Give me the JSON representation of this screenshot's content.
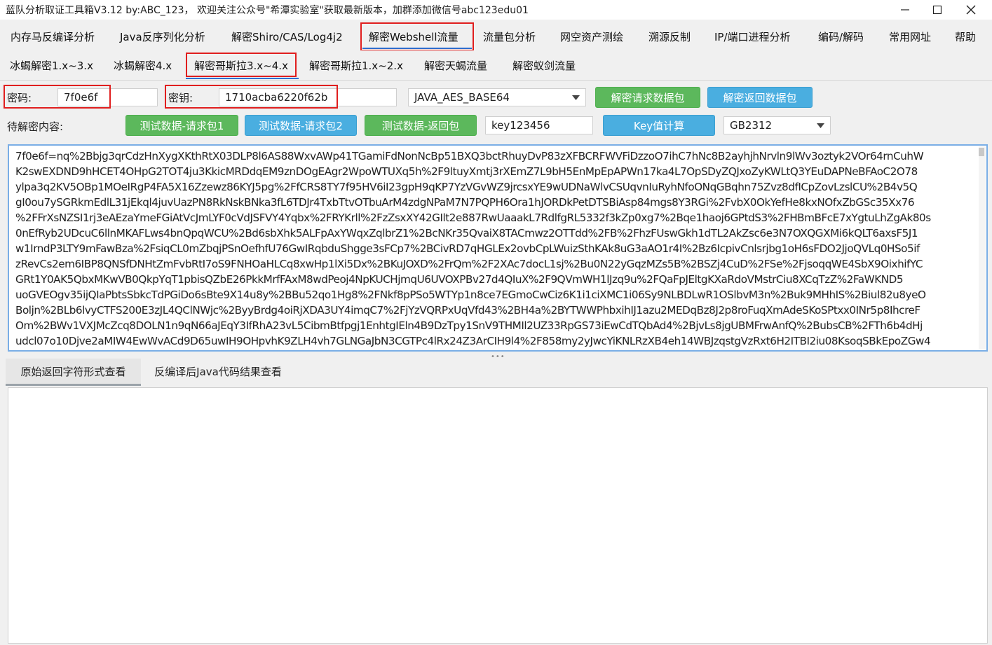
{
  "window": {
    "title": "蓝队分析取证工具箱V3.12 by:ABC_123， 欢迎关注公众号\"希潭实验室\"获取最新版本，加群添加微信号abc123edu01"
  },
  "menu": {
    "items": [
      {
        "label": "内存马反编译分析"
      },
      {
        "label": "Java反序列化分析"
      },
      {
        "label": "解密Shiro/CAS/Log4j2"
      },
      {
        "label": "解密Webshell流量"
      },
      {
        "label": "流量包分析"
      },
      {
        "label": "网空资产测绘"
      },
      {
        "label": "溯源反制"
      },
      {
        "label": "IP/端口进程分析"
      },
      {
        "label": "编码/解码"
      },
      {
        "label": "常用网址"
      },
      {
        "label": "帮助"
      }
    ],
    "active": "解密Webshell流量"
  },
  "subtabs": {
    "items": [
      {
        "label": "冰蝎解密1.x~3.x"
      },
      {
        "label": "冰蝎解密4.x"
      },
      {
        "label": "解密哥斯拉3.x~4.x"
      },
      {
        "label": "解密哥斯拉1.x~2.x"
      },
      {
        "label": "解密天蝎流量"
      },
      {
        "label": "解密蚁剑流量"
      }
    ],
    "active": "解密哥斯拉3.x~4.x"
  },
  "form": {
    "password_label": "密码:",
    "password_value": "7f0e6f",
    "key_label": "密钥:",
    "key_value": "1710acba6220f62b",
    "mode_select": "JAVA_AES_BASE64",
    "decrypt_request_button": "解密请求数据包",
    "decrypt_response_button": "解密返回数据包",
    "content_label": "待解密内容:",
    "test_req1_button": "测试数据-请求包1",
    "test_req2_button": "测试数据-请求包2",
    "test_resp_button": "测试数据-返回包",
    "key_input_value": "key123456",
    "key_calc_button": "Key值计算",
    "encoding_select": "GB2312"
  },
  "content": {
    "lines": [
      "7f0e6f=nq%2Bbjg3qrCdzHnXygXKthRtX03DLP8l6AS88WxvAWp41TGamiFdNonNcBp51BXQ3bctRhuyDvP83zXFBCRFWVFiDzzoO7ihC7hNc8B2ayhjhNrvln9lWv3oztyk2VOr64rnCuhW",
      "K2swEXDND9hHCET4OHpG2TOT4ju3KkicMRDdqEM9znDOgEAgr2WpoWTUXq5h%2F9ltuyXmtj3rXEmZ7L9bH5EnMpEpAPWn17ka4L7OpSDyZQJxoZyKWLtQ3YEuDAPNeBFAoC2O78",
      "ylpa3q2KV5OBp1MOeIRgP4FA5X16Zzewz86KYJ5pg%2FfCRS8TY7f95HV6iI23gpH9qKP7YzVGvWZ9jrcsxYE9wUDNaWlvCSUqvnIuRyhNfoONqGBqhn75Zvz8dfICpZovLzslCU%2B4v5Q",
      "gI0ou7ySGRkmEdlL31jEkql4juvUazPN8RkNskBNka3fL6TDJr4TxbTtvOTbuArM4zdgNPaM7N7PQPH6Ora1hJORDkPetDTSBiAsp84mgs8Y3RGi%2FvbX0OkYefHe8kxNOfxZbGSc35Xx76",
      "%2FFrXsNZSI1rj3eAEzaYmeFGiAtVcJmLYF0cVdJSFVY4Yqbx%2FRYKrll%2FzZsxXY42GIlt2e887RwUaaakL7RdlfgRL5332f3kZp0xg7%2Bqe1haoj6GPtdS3%2FHBmBFcE7xYgtuLhZgAk80s",
      "0nEfRyb2UDcuC6llnMKAFLws4bnQpqWCU%2Bd6sbXhk5ALFpAxYWqxZqlbrZ1%2BcNKr35QvaiX8TACmwz2OTTdd%2FB%2FhzFUswGkh1dTL2AkZsc6e3N7OXQGXMi6kQLT6axsF5J1",
      "w1IrndP3LTY9mFawBza%2FsiqCL0mZbqjPSnOefhfU76GwIRqbduShgge3sFCp7%2BCivRD7qHGLEx2ovbCpLWuizSthKAk8uG3aAO1r4I%2Bz6IcpivCnlsrjbg1oH6sFDO2JjoQVLq0HSo5if",
      "zRevCs2em6IBP8QNSfDNHtZmFvbRtI7oS9FNHOaHLCq8xwHp1lXi5Dx%2BKuJOXD%2FrQm%2F2XAc7docL1sj%2Bu0N22yGqzMZs5B%2BSZj4CuD%2FSe%2FjsoqqWE4SbX9OixhifYC",
      "GRt1Y0AK5QbxMKwVB0QkpYqT1pbisQZbE26PkkMrfFAxM8wdPeoj4NpKUCHjmqU6UVOXPBv27d4QIuX%2F9QVmWH1lJzq9u%2FQaFpJEltgKXaRdoVMstrCiu8XCqTzZ%2FaWKND5",
      "uoGVEOgv35ijQIaPbtsSbkcTdPGiDo6sBte9X14u8y%2BBu52qo1Hg8%2FNkf8pPSo5WTYp1n8ce7EGmoCwCiz6K1i1ciXMC1i06Sy9NLBDLwR1OSlbvM3n%2Buk9MHhIS%2Biul82u8yeO",
      "Boljn%2BLb6lvyCTFS200E3zJL4QClNWjc%2ByyBrdg4oiRjXDA3UY4imqC7%2FjYzVQRPxUqVfd43%2BH4a%2BYTWWPhbxihIJ1azu2MEDqBz8J2p8roFuqXmAdeSKoSPtxx0INr5p8IhcreF",
      "Om%2BWv1VXJMcZcq8DOLN1n9qN66aJEqY3IfRhA23vL5CibmBtfpgj1EnhtgIEln4B9DzTpy1SnV9THMIl2UZ33RpGS73iEwCdTQbAd4%2BjvLs8jgUBMFrwAnfQ%2BubsCB%2FTh6b4dHj",
      "udcl07o10Djve2aMIW4EwWvACd9D65uwIH9OHpvhK9ZLH4vh7GLNGaJbN3CGTPc4lRx24Z3ArCIH9l4%2F858my2yJwcYiKNLRzXB4eh14WBJzqstgVzRxt6H2ITBI2iu08KsoqSBkEpoZGw4"
    ]
  },
  "bottom_tabs": {
    "raw_tab": "原始返回字符形式查看",
    "java_tab": "反编译后Java代码结果查看"
  },
  "icons": {
    "minimize": "minimize-icon",
    "maximize": "maximize-icon",
    "close": "close-icon",
    "dropdown": "chevron-down-icon"
  },
  "colors": {
    "highlight_box": "#e01e1e",
    "active_underline": "#2f6fcf",
    "green_button": "#5cb85c",
    "blue_button": "#4aaee0",
    "textarea_border": "#7aaee6"
  }
}
